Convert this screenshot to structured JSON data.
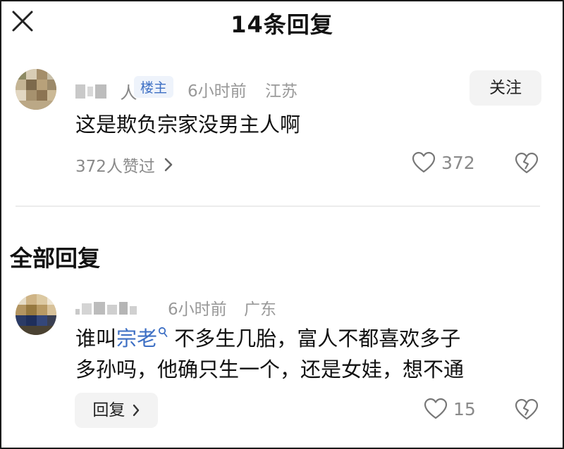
{
  "header": {
    "title": "14条回复"
  },
  "op_comment": {
    "username": "   人",
    "badge": "楼主",
    "time": "6小时前",
    "location": "江苏",
    "follow_label": "关注",
    "text": "这是欺负宗家没男主人啊",
    "likes_summary": "372人赞过",
    "like_count": "372"
  },
  "section": {
    "title": "全部回复"
  },
  "replies": [
    {
      "username": "",
      "time": "6小时前",
      "location": "广东",
      "text_before": "谁叫",
      "keyword": "宗老",
      "text_line1_after": " 不多生几胎，富人不都喜欢多子",
      "text_line2": "多孙吗，他确只生一个，还是女娃，想不通",
      "reply_label": "回复",
      "like_count": "15"
    }
  ],
  "colors": {
    "accent": "#3d6fc4",
    "muted": "#8a8a8a"
  }
}
